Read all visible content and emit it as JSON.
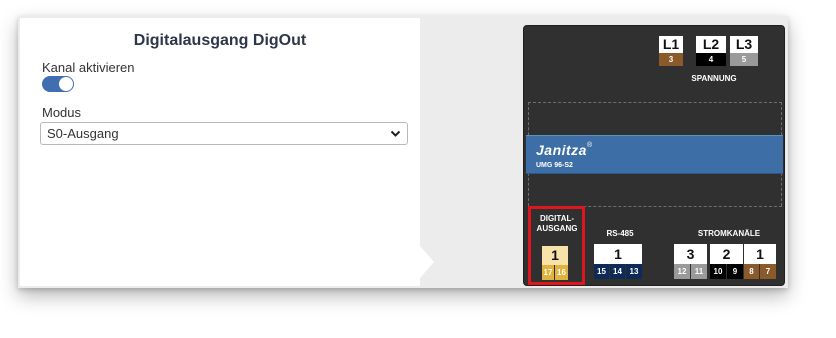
{
  "config_panel": {
    "title": "Digitalausgang DigOut",
    "channel_label": "Kanal aktivieren",
    "channel_enabled": true,
    "mode_label": "Modus",
    "mode_value": "S0-Ausgang"
  },
  "device": {
    "brand": "Janitza",
    "brand_mark": "®",
    "model": "UMG 96-S2",
    "voltage": {
      "label": "SPANNUNG",
      "terminals": [
        {
          "label": "L1",
          "number": "3",
          "color": "#8b5a2b"
        },
        {
          "label": "L2",
          "number": "4",
          "color": "#000000"
        },
        {
          "label": "L3",
          "number": "5",
          "color": "#9a9a9a"
        }
      ]
    },
    "digital_output": {
      "label_line1": "DIGITAL-",
      "label_line2": "AUSGANG",
      "channel": "1",
      "pins": [
        "17",
        "16"
      ],
      "color": "#e2b23f",
      "highlight_color": "#e0161f"
    },
    "rs485": {
      "label": "RS-485",
      "channel": "1",
      "pins": [
        "15",
        "14",
        "13"
      ],
      "color": "#0e2a57"
    },
    "current_channels": {
      "label": "STROMKANÄLE",
      "channels": [
        {
          "label": "3",
          "pins": [
            "12",
            "11"
          ],
          "color": "#9a9a9a"
        },
        {
          "label": "2",
          "pins": [
            "10",
            "9"
          ],
          "color": "#000000"
        },
        {
          "label": "1",
          "pins": [
            "8",
            "7"
          ],
          "color": "#8b5a2b"
        }
      ]
    }
  }
}
